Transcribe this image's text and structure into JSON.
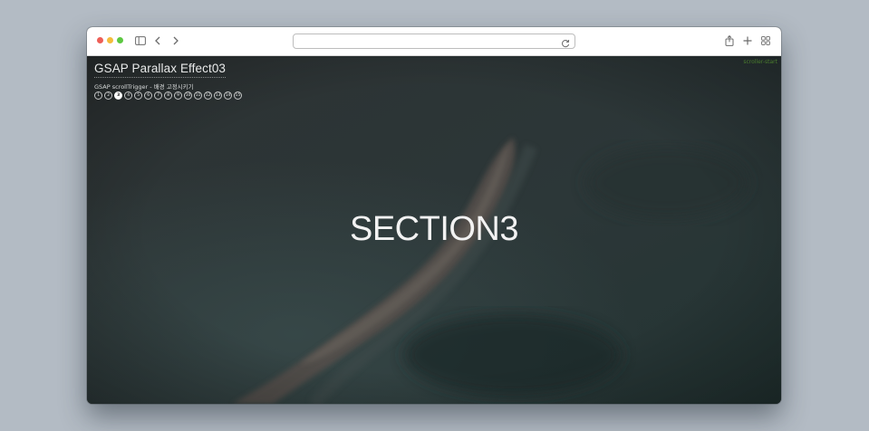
{
  "browser": {
    "url": "",
    "icons": [
      "sidebar-icon",
      "back-icon",
      "forward-icon",
      "reload-icon",
      "share-icon",
      "new-tab-icon",
      "tab-overview-icon"
    ]
  },
  "page": {
    "title": "GSAP Parallax Effect03",
    "subtitle": "GSAP scrollTrigger - 배경 고정시키기",
    "corner_label": "scroller-start",
    "section_heading": "SECTION3",
    "pager": {
      "active_index": 2,
      "items": [
        "1",
        "2",
        "3",
        "4",
        "5",
        "6",
        "7",
        "8",
        "9",
        "10",
        "11",
        "12",
        "13",
        "14",
        "15"
      ]
    },
    "colors": {
      "overlay": "#2c3536",
      "text": "#f2f2f2",
      "active_dot": "#ffffff",
      "corner_label": "#4a7d2e"
    }
  }
}
